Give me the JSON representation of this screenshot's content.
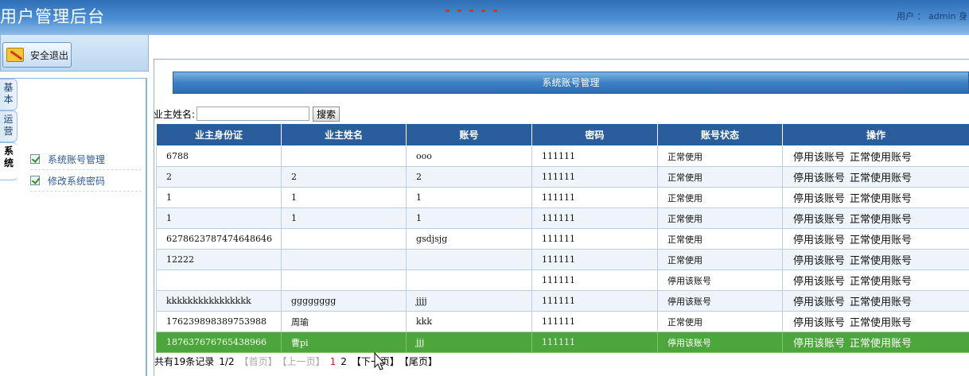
{
  "header": {
    "title": "用户管理后台",
    "user_label": "用户 ： admin  身"
  },
  "sidebar": {
    "logout_label": "安全退出",
    "tabs": [
      "基本",
      "运营",
      "系统"
    ],
    "menu": [
      "系统账号管理",
      "修改系统密码"
    ]
  },
  "main": {
    "title": "系统账号管理",
    "search_label": "业主姓名:",
    "search_value": "",
    "search_button": "搜索",
    "columns": [
      "业主身份证",
      "业主姓名",
      "账号",
      "密码",
      "账号状态",
      "操作"
    ],
    "rows": [
      {
        "id_card": "6788",
        "name": "",
        "account": "ooo",
        "password": "111111",
        "status": "正常使用"
      },
      {
        "id_card": "2",
        "name": "2",
        "account": "2",
        "password": "111111",
        "status": "正常使用"
      },
      {
        "id_card": "1",
        "name": "1",
        "account": "1",
        "password": "111111",
        "status": "正常使用"
      },
      {
        "id_card": "1",
        "name": "1",
        "account": "1",
        "password": "111111",
        "status": "正常使用"
      },
      {
        "id_card": "6278623787474648646",
        "name": "",
        "account": "gsdjsjg",
        "password": "111111",
        "status": "正常使用"
      },
      {
        "id_card": "12222",
        "name": "",
        "account": "",
        "password": "111111",
        "status": "正常使用"
      },
      {
        "id_card": "",
        "name": "",
        "account": "",
        "password": "111111",
        "status": "停用该账号"
      },
      {
        "id_card": "kkkkkkkkkkkkkkkk",
        "name": "gggggggg",
        "account": "jjjj",
        "password": "111111",
        "status": "停用该账号"
      },
      {
        "id_card": "176239898389753988",
        "name": "周瑜",
        "account": "kkk",
        "password": "111111",
        "status": "正常使用"
      },
      {
        "id_card": "187637676765438966",
        "name": "曹pi",
        "account": "jjj",
        "password": "111111",
        "status": "停用该账号"
      }
    ],
    "op_disable": "停用该账号",
    "op_enable": "正常使用账号",
    "selected_row_index": 9,
    "selected_color": "#4da63b"
  },
  "pager": {
    "total": "共有19条记录",
    "pages": "1/2",
    "first": "【首页】",
    "prev": "【上一页】",
    "page1": "1",
    "page2": "2",
    "next": "【下一页】",
    "last": "【尾页】"
  }
}
